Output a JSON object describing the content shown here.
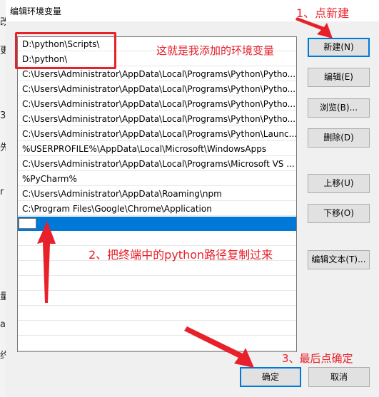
{
  "window": {
    "title": "编辑环境变量"
  },
  "paths": [
    "D:\\python\\Scripts\\",
    "D:\\python\\",
    "C:\\Users\\Administrator\\AppData\\Local\\Programs\\Python\\Pytho...",
    "C:\\Users\\Administrator\\AppData\\Local\\Programs\\Python\\Pytho...",
    "C:\\Users\\Administrator\\AppData\\Local\\Programs\\Python\\Pytho...",
    "C:\\Users\\Administrator\\AppData\\Local\\Programs\\Python\\Pytho...",
    "C:\\Users\\Administrator\\AppData\\Local\\Programs\\Python\\Launc...",
    "%USERPROFILE%\\AppData\\Local\\Microsoft\\WindowsApps",
    "C:\\Users\\Administrator\\AppData\\Local\\Programs\\Microsoft VS ...",
    "%PyCharm%",
    "C:\\Users\\Administrator\\AppData\\Roaming\\npm",
    "C:\\Program Files\\Google\\Chrome\\Application",
    ""
  ],
  "buttons": {
    "new": "新建(N)",
    "edit": "编辑(E)",
    "browse": "浏览(B)...",
    "delete": "删除(D)",
    "move_up": "上移(U)",
    "move_down": "下移(O)",
    "edit_text": "编辑文本(T)...",
    "ok": "确定",
    "cancel": "取消"
  },
  "annotations": {
    "step1": "1、点新建",
    "added_note": "这就是我添加的环境变量",
    "step2": "2、把终端中的python路径复制过来",
    "step3": "3、最后点确定"
  },
  "left_strip_chars": [
    "改",
    "更",
    "3",
    "先",
    "r",
    "量",
    "a",
    "约"
  ],
  "colors": {
    "annotation_red": "#e8202a",
    "selection_blue": "#0078d7"
  }
}
